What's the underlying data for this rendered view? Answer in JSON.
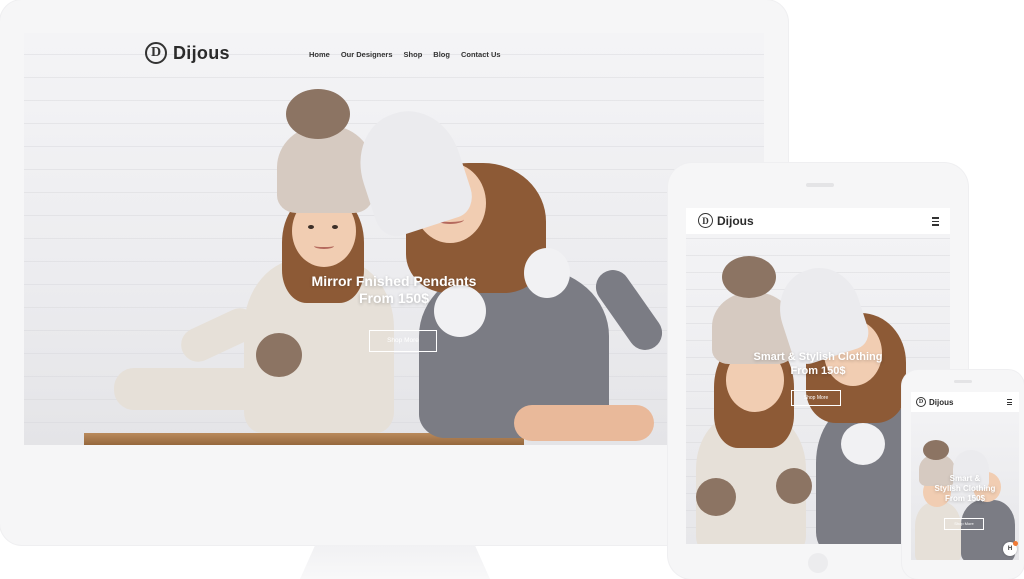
{
  "brand": {
    "logo_letter": "D",
    "name": "Dijous"
  },
  "desktop": {
    "nav": [
      "Home",
      "Our Designers",
      "Shop",
      "Blog",
      "Contact Us"
    ],
    "hero_title_line1": "Mirror Fnished Pendants",
    "hero_title_line2": "From 150$",
    "hero_button": "Shop More"
  },
  "tablet": {
    "hero_title_line1": "Smart & Stylish Clothing",
    "hero_title_line2": "From 150$",
    "hero_button": "Shop More",
    "menu_icon": "hamburger-menu-icon"
  },
  "phone": {
    "hero_title_line1": "Smart &",
    "hero_title_line2": "Stylish Clothing",
    "hero_title_line3": "From 150$",
    "hero_button": "Shop More",
    "menu_icon": "hamburger-menu-icon",
    "badge_letter": "H"
  },
  "colors": {
    "device_frame": "#f6f6f7",
    "text_dark": "#2b2b2b",
    "hero_text": "#ffffff",
    "badge_dot": "#f07a36"
  }
}
